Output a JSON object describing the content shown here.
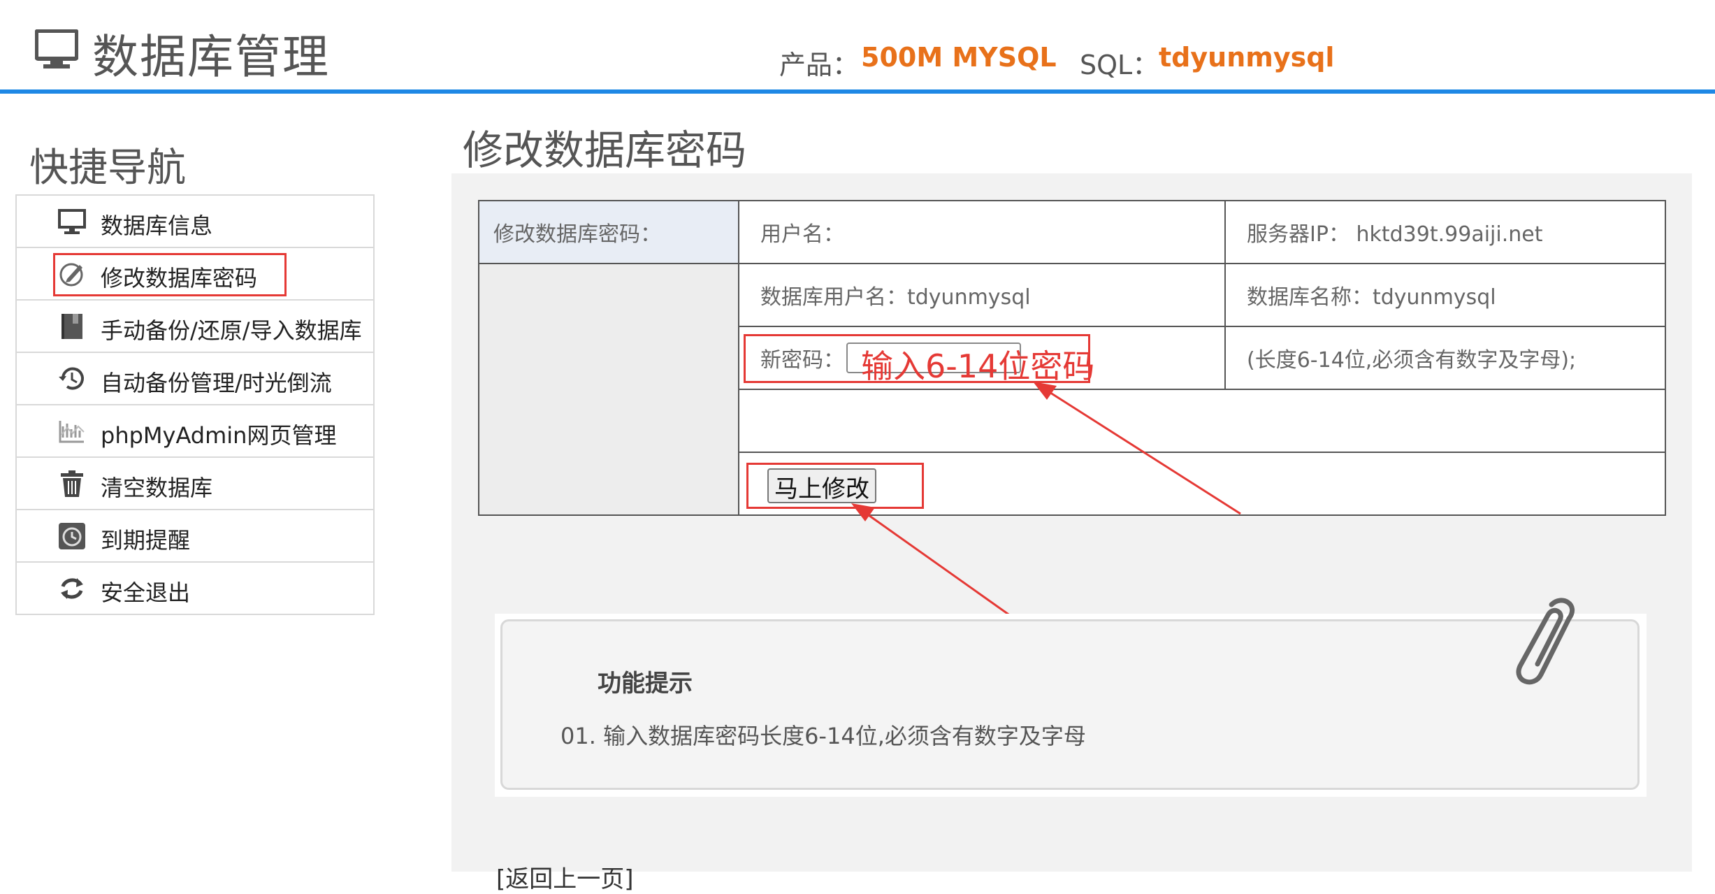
{
  "header": {
    "title": "数据库管理",
    "product_label": "产品：",
    "product_value": "500M MYSQL",
    "sql_label": "SQL：",
    "sql_value": "tdyunmysql",
    "accent_color": "#1e88e5",
    "highlight_color": "#e8711a"
  },
  "nav": {
    "title": "快捷导航",
    "items": [
      {
        "label": "数据库信息",
        "icon": "monitor-icon"
      },
      {
        "label": "修改数据库密码",
        "icon": "edit-icon"
      },
      {
        "label": "手动备份/还原/导入数据库",
        "icon": "book-icon"
      },
      {
        "label": "自动备份管理/时光倒流",
        "icon": "history-icon"
      },
      {
        "label": "phpMyAdmin网页管理",
        "icon": "chart-icon"
      },
      {
        "label": "清空数据库",
        "icon": "trash-icon"
      },
      {
        "label": "到期提醒",
        "icon": "clock-icon"
      },
      {
        "label": "安全退出",
        "icon": "refresh-icon"
      }
    ]
  },
  "main": {
    "title": "修改数据库密码",
    "form": {
      "side_header": "修改数据库密码：",
      "username_label": "用户名：",
      "server_ip": "服务器IP： hktd39t.99aiji.net",
      "db_user": "数据库用户名：tdyunmysql",
      "db_name": "数据库名称：tdyunmysql",
      "new_password_label": "新密码：",
      "new_password_value": "",
      "password_annotation": "输入6-14位密码",
      "password_hint": "(长度6-14位,必须含有数字及字母);",
      "submit_label": "马上修改"
    },
    "tips": {
      "title": "功能提示",
      "items": [
        "01. 输入数据库密码长度6-14位,必须含有数字及字母"
      ]
    },
    "back_link": "[返回上一页]"
  },
  "annotation_color": "#e53935"
}
